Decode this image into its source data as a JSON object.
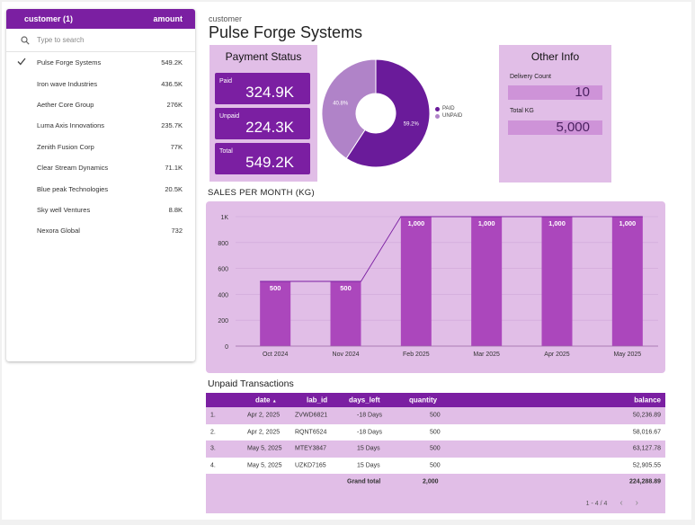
{
  "customer_panel": {
    "header_label": "customer (1)",
    "header_amount": "amount",
    "search_placeholder": "Type to search",
    "items": [
      {
        "name": "Pulse Forge Systems",
        "amount": "549.2K",
        "checked": true
      },
      {
        "name": "Iron wave Industries",
        "amount": "436.5K",
        "checked": false
      },
      {
        "name": "Aether Core Group",
        "amount": "276K",
        "checked": false
      },
      {
        "name": "Luma Axis Innovations",
        "amount": "235.7K",
        "checked": false
      },
      {
        "name": "Zenith Fusion Corp",
        "amount": "77K",
        "checked": false
      },
      {
        "name": "Clear Stream Dynamics",
        "amount": "71.1K",
        "checked": false
      },
      {
        "name": "Blue peak Technologies",
        "amount": "20.5K",
        "checked": false
      },
      {
        "name": "Sky well Ventures",
        "amount": "8.8K",
        "checked": false
      },
      {
        "name": "Nexora Global",
        "amount": "732",
        "checked": false
      }
    ]
  },
  "title": {
    "small": "customer",
    "big": "Pulse Forge Systems"
  },
  "payment_status": {
    "title": "Payment Status",
    "paid_label": "Paid",
    "paid_value": "324.9K",
    "unpaid_label": "Unpaid",
    "unpaid_value": "224.3K",
    "total_label": "Total",
    "total_value": "549.2K"
  },
  "pie": {
    "paid_pct": 59.2,
    "unpaid_pct": 40.8,
    "paid_label": "59.2%",
    "unpaid_label": "40.8%",
    "legend_paid": "PAID",
    "legend_unpaid": "UNPAID",
    "paid_color": "#6a1b9a",
    "unpaid_color": "#b083c8"
  },
  "other_info": {
    "title": "Other Info",
    "delivery_label": "Delivery Count",
    "delivery_value": "10",
    "total_kg_label": "Total KG",
    "total_kg_value": "5,000"
  },
  "chart_data": {
    "type": "bar",
    "title": "SALES PER MONTH (KG)",
    "categories": [
      "Oct 2024",
      "Nov 2024",
      "Feb 2025",
      "Mar 2025",
      "Apr 2025",
      "May 2025"
    ],
    "values": [
      500,
      500,
      1000,
      1000,
      1000,
      1000
    ],
    "data_labels": [
      "500",
      "500",
      "1,000",
      "1,000",
      "1,000",
      "1,000"
    ],
    "ylim": [
      0,
      1000
    ],
    "yticks": [
      "0",
      "200",
      "400",
      "600",
      "800",
      "1K"
    ],
    "ytick_values": [
      0,
      200,
      400,
      600,
      800,
      1000
    ],
    "bar_color": "#ab47bc",
    "line_color": "#7b1fa2",
    "grid": true
  },
  "table": {
    "title": "Unpaid Transactions",
    "columns": [
      "date",
      "lab_id",
      "days_left",
      "quantity",
      "balance"
    ],
    "sort_indicator": "▲",
    "rows": [
      {
        "n": "1.",
        "date": "Apr 2, 2025",
        "lab_id": "ZVWD6821",
        "days_left": "-18 Days",
        "quantity": "500",
        "balance": "50,236.89"
      },
      {
        "n": "2.",
        "date": "Apr 2, 2025",
        "lab_id": "RQNT6524",
        "days_left": "-18 Days",
        "quantity": "500",
        "balance": "58,016.67"
      },
      {
        "n": "3.",
        "date": "May 5, 2025",
        "lab_id": "MTEY3847",
        "days_left": "15 Days",
        "quantity": "500",
        "balance": "63,127.78"
      },
      {
        "n": "4.",
        "date": "May 5, 2025",
        "lab_id": "UZKD7165",
        "days_left": "15 Days",
        "quantity": "500",
        "balance": "52,905.55"
      }
    ],
    "grand_total_label": "Grand total",
    "grand_total_quantity": "2,000",
    "grand_total_balance": "224,288.89",
    "pager_text": "1 - 4 / 4",
    "pager_prev": "‹",
    "pager_next": "›"
  }
}
